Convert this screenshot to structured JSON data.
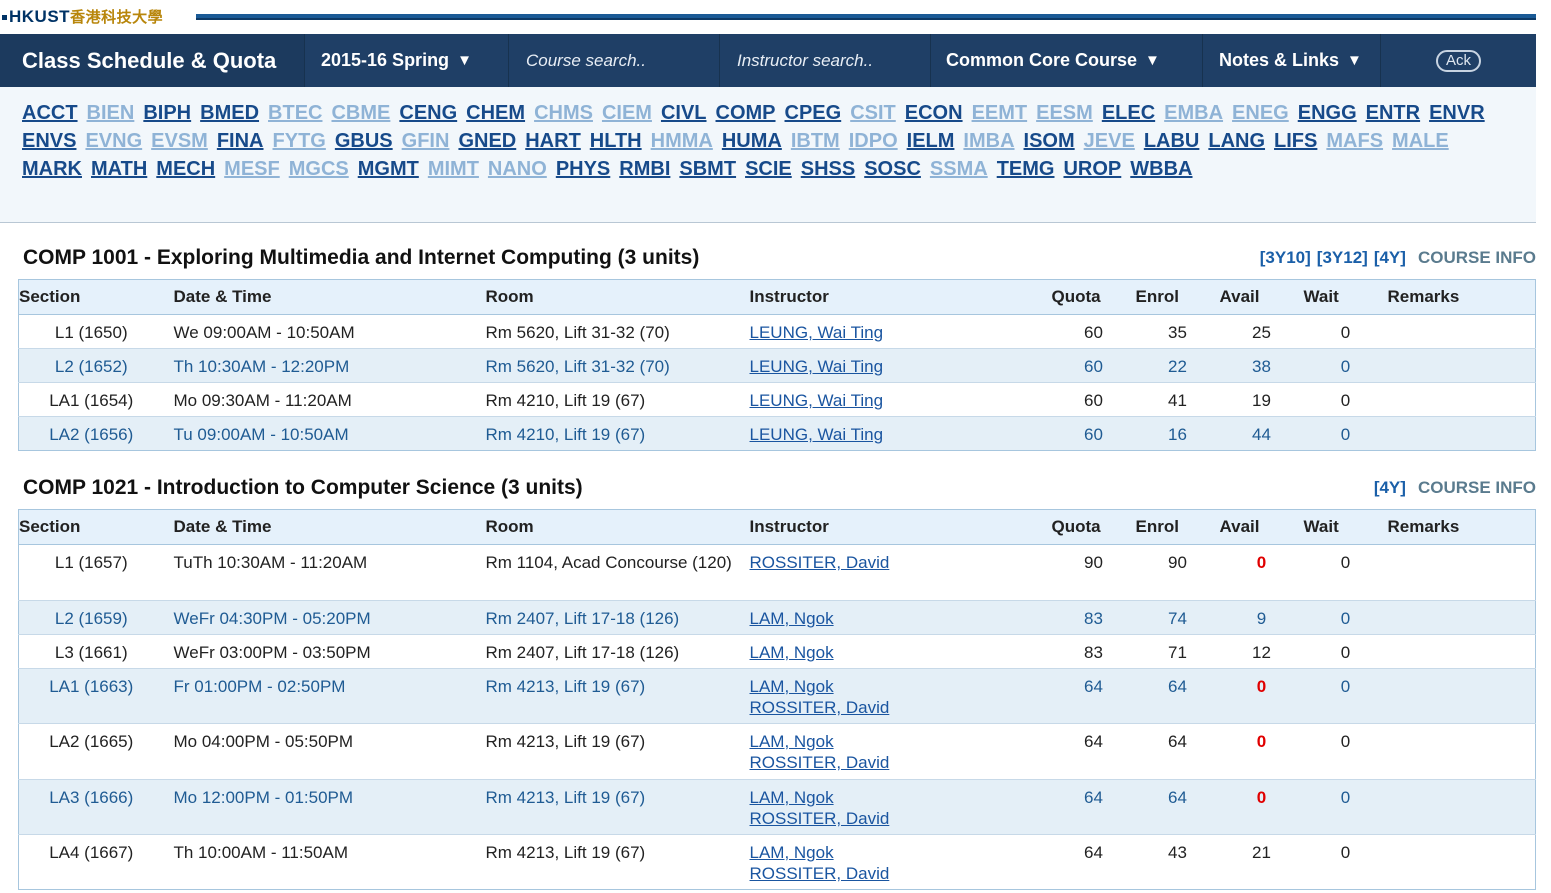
{
  "logo": {
    "text": "HKUST",
    "cn": "香港科技大學"
  },
  "navbar": {
    "title": "Class Schedule & Quota",
    "term": "2015-16 Spring",
    "course_search_placeholder": "Course search..",
    "instructor_search_placeholder": "Instructor search..",
    "common_core": "Common Core Course",
    "notes": "Notes & Links",
    "ack": "Ack"
  },
  "departments": [
    {
      "code": "ACCT",
      "active": true
    },
    {
      "code": "BIEN",
      "active": false
    },
    {
      "code": "BIPH",
      "active": true
    },
    {
      "code": "BMED",
      "active": true
    },
    {
      "code": "BTEC",
      "active": false
    },
    {
      "code": "CBME",
      "active": false
    },
    {
      "code": "CENG",
      "active": true
    },
    {
      "code": "CHEM",
      "active": true
    },
    {
      "code": "CHMS",
      "active": false
    },
    {
      "code": "CIEM",
      "active": false
    },
    {
      "code": "CIVL",
      "active": true
    },
    {
      "code": "COMP",
      "active": true
    },
    {
      "code": "CPEG",
      "active": true
    },
    {
      "code": "CSIT",
      "active": false
    },
    {
      "code": "ECON",
      "active": true
    },
    {
      "code": "EEMT",
      "active": false
    },
    {
      "code": "EESM",
      "active": false
    },
    {
      "code": "ELEC",
      "active": true
    },
    {
      "code": "EMBA",
      "active": false
    },
    {
      "code": "ENEG",
      "active": false
    },
    {
      "code": "ENGG",
      "active": true
    },
    {
      "code": "ENTR",
      "active": true
    },
    {
      "code": "ENVR",
      "active": true
    },
    {
      "code": "ENVS",
      "active": true
    },
    {
      "code": "EVNG",
      "active": false
    },
    {
      "code": "EVSM",
      "active": false
    },
    {
      "code": "FINA",
      "active": true
    },
    {
      "code": "FYTG",
      "active": false
    },
    {
      "code": "GBUS",
      "active": true
    },
    {
      "code": "GFIN",
      "active": false
    },
    {
      "code": "GNED",
      "active": true
    },
    {
      "code": "HART",
      "active": true
    },
    {
      "code": "HLTH",
      "active": true
    },
    {
      "code": "HMMA",
      "active": false
    },
    {
      "code": "HUMA",
      "active": true
    },
    {
      "code": "IBTM",
      "active": false
    },
    {
      "code": "IDPO",
      "active": false
    },
    {
      "code": "IELM",
      "active": true
    },
    {
      "code": "IMBA",
      "active": false
    },
    {
      "code": "ISOM",
      "active": true
    },
    {
      "code": "JEVE",
      "active": false
    },
    {
      "code": "LABU",
      "active": true
    },
    {
      "code": "LANG",
      "active": true
    },
    {
      "code": "LIFS",
      "active": true
    },
    {
      "code": "MAFS",
      "active": false
    },
    {
      "code": "MALE",
      "active": false
    },
    {
      "code": "MARK",
      "active": true
    },
    {
      "code": "MATH",
      "active": true
    },
    {
      "code": "MECH",
      "active": true
    },
    {
      "code": "MESF",
      "active": false
    },
    {
      "code": "MGCS",
      "active": false
    },
    {
      "code": "MGMT",
      "active": true
    },
    {
      "code": "MIMT",
      "active": false
    },
    {
      "code": "NANO",
      "active": false
    },
    {
      "code": "PHYS",
      "active": true
    },
    {
      "code": "RMBI",
      "active": true
    },
    {
      "code": "SBMT",
      "active": true
    },
    {
      "code": "SCIE",
      "active": true
    },
    {
      "code": "SHSS",
      "active": true
    },
    {
      "code": "SOSC",
      "active": true
    },
    {
      "code": "SSMA",
      "active": false
    },
    {
      "code": "TEMG",
      "active": true
    },
    {
      "code": "UROP",
      "active": true
    },
    {
      "code": "WBBA",
      "active": true
    }
  ],
  "table_headers": {
    "section": "Section",
    "datetime": "Date & Time",
    "room": "Room",
    "instructor": "Instructor",
    "quota": "Quota",
    "enrol": "Enrol",
    "avail": "Avail",
    "wait": "Wait",
    "remarks": "Remarks"
  },
  "courses": [
    {
      "title": "COMP 1001 - Exploring Multimedia and Internet Computing (3 units)",
      "links": [
        "[3Y10]",
        "[3Y12]",
        "[4Y]"
      ],
      "info": "COURSE INFO",
      "sections": [
        {
          "section": "L1 (1650)",
          "datetime": "We 09:00AM - 10:50AM",
          "room": "Rm 5620, Lift 31-32 (70)",
          "instructors": [
            "LEUNG, Wai Ting"
          ],
          "quota": "60",
          "enrol": "35",
          "avail": "25",
          "wait": "0",
          "remarks": ""
        },
        {
          "section": "L2 (1652)",
          "datetime": "Th 10:30AM - 12:20PM",
          "room": "Rm 5620, Lift 31-32 (70)",
          "instructors": [
            "LEUNG, Wai Ting"
          ],
          "quota": "60",
          "enrol": "22",
          "avail": "38",
          "wait": "0",
          "remarks": ""
        },
        {
          "section": "LA1 (1654)",
          "datetime": "Mo 09:30AM - 11:20AM",
          "room": "Rm 4210, Lift 19 (67)",
          "instructors": [
            "LEUNG, Wai Ting"
          ],
          "quota": "60",
          "enrol": "41",
          "avail": "19",
          "wait": "0",
          "remarks": ""
        },
        {
          "section": "LA2 (1656)",
          "datetime": "Tu 09:00AM - 10:50AM",
          "room": "Rm 4210, Lift 19 (67)",
          "instructors": [
            "LEUNG, Wai Ting"
          ],
          "quota": "60",
          "enrol": "16",
          "avail": "44",
          "wait": "0",
          "remarks": ""
        }
      ]
    },
    {
      "title": "COMP 1021 - Introduction to Computer Science (3 units)",
      "links": [
        "[4Y]"
      ],
      "info": "COURSE INFO",
      "sections": [
        {
          "section": "L1 (1657)",
          "datetime": "TuTh 10:30AM - 11:20AM",
          "room": "Rm 1104, Acad Concourse (120)",
          "instructors": [
            "ROSSITER, David"
          ],
          "quota": "90",
          "enrol": "90",
          "avail": "0",
          "wait": "0",
          "remarks": ""
        },
        {
          "section": "L2 (1659)",
          "datetime": "WeFr 04:30PM - 05:20PM",
          "room": "Rm 2407, Lift 17-18 (126)",
          "instructors": [
            "LAM, Ngok"
          ],
          "quota": "83",
          "enrol": "74",
          "avail": "9",
          "wait": "0",
          "remarks": ""
        },
        {
          "section": "L3 (1661)",
          "datetime": "WeFr 03:00PM - 03:50PM",
          "room": "Rm 2407, Lift 17-18 (126)",
          "instructors": [
            "LAM, Ngok"
          ],
          "quota": "83",
          "enrol": "71",
          "avail": "12",
          "wait": "0",
          "remarks": ""
        },
        {
          "section": "LA1 (1663)",
          "datetime": "Fr 01:00PM - 02:50PM",
          "room": "Rm 4213, Lift 19 (67)",
          "instructors": [
            "LAM, Ngok",
            "ROSSITER, David"
          ],
          "quota": "64",
          "enrol": "64",
          "avail": "0",
          "wait": "0",
          "remarks": ""
        },
        {
          "section": "LA2 (1665)",
          "datetime": "Mo 04:00PM - 05:50PM",
          "room": "Rm 4213, Lift 19 (67)",
          "instructors": [
            "LAM, Ngok",
            "ROSSITER, David"
          ],
          "quota": "64",
          "enrol": "64",
          "avail": "0",
          "wait": "0",
          "remarks": ""
        },
        {
          "section": "LA3 (1666)",
          "datetime": "Mo 12:00PM - 01:50PM",
          "room": "Rm 4213, Lift 19 (67)",
          "instructors": [
            "LAM, Ngok",
            "ROSSITER, David"
          ],
          "quota": "64",
          "enrol": "64",
          "avail": "0",
          "wait": "0",
          "remarks": ""
        },
        {
          "section": "LA4 (1667)",
          "datetime": "Th 10:00AM - 11:50AM",
          "room": "Rm 4213, Lift 19 (67)",
          "instructors": [
            "LAM, Ngok",
            "ROSSITER, David"
          ],
          "quota": "64",
          "enrol": "43",
          "avail": "21",
          "wait": "0",
          "remarks": ""
        }
      ]
    }
  ]
}
